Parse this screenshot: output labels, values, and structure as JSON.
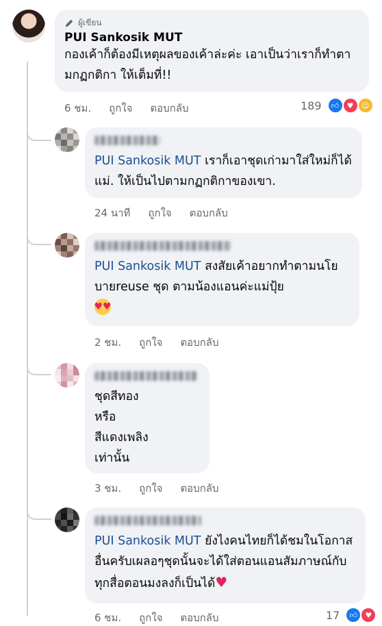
{
  "main_comment": {
    "badge": "ผู้เขียน",
    "author": "PUI Sankosik MUT",
    "text": "กองเค้าก็ต้องมีเหตุผลของเค้าล่ะค่ะ เอาเป็นว่าเราก็ทำตามกฏกติกา ให้เต็มที่!!",
    "time": "6 ชม.",
    "like_label": "ถูกใจ",
    "reply_label": "ตอบกลับ",
    "reaction_count": "189",
    "reactions": [
      "like-icon",
      "love-icon",
      "care-icon"
    ]
  },
  "replies": [
    {
      "mention": "PUI Sankosik MUT",
      "text": " เราก็เอาชุดเก่ามาใส่ใหม่ก็ได้แม่. ให้เป็นไปตามกฏกติกาของเขา.",
      "time": "24 นาที",
      "like_label": "ถูกใจ",
      "reply_label": "ตอบกลับ"
    },
    {
      "mention": "PUI Sankosik MUT",
      "text": " สงสัยเค้าอยากทำตามนโยบายreuse ชุด ตามน้องแอนค่ะแม่ปุ้ย",
      "emoji": "heart-eyes-emoji",
      "time": "2 ชม.",
      "like_label": "ถูกใจ",
      "reply_label": "ตอบกลับ"
    },
    {
      "lines": [
        "ชุดสีทอง",
        "หรือ",
        "สีแดงเพลิง",
        "เท่านั้น"
      ],
      "time": "3 ชม.",
      "like_label": "ถูกใจ",
      "reply_label": "ตอบกลับ"
    },
    {
      "mention": "PUI Sankosik MUT",
      "text": " ยังไงคนไทยก็ได้ชมในโอกาสอื่นครับเผลอๆชุดนั้นจะได้ใส่ตอนแอนสัมภาษณ์กับทุกสื่อตอนมงลงก็เป็นได้",
      "emoji": "red-heart-emoji",
      "time": "6 ชม.",
      "like_label": "ถูกใจ",
      "reply_label": "ตอบกลับ",
      "reaction_count": "17"
    }
  ],
  "colors": {
    "bubble": "#f0f2f5",
    "mention": "#1d4f91",
    "meta": "#65676b",
    "like": "#1877f2",
    "love": "#f33e58"
  }
}
